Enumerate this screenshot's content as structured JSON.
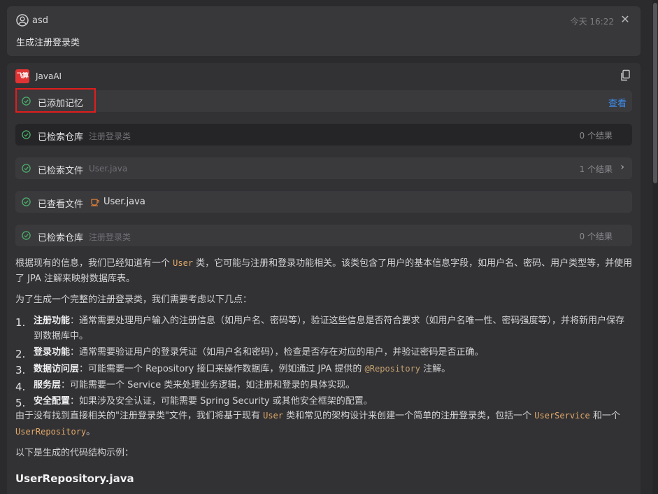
{
  "user": {
    "name": "asd",
    "time": "今天 16:22",
    "message": "生成注册登录类"
  },
  "ai": {
    "logo_text": "飞算",
    "name": "JavaAI"
  },
  "steps": [
    {
      "label": "已添加记忆",
      "action": "查看"
    },
    {
      "label": "已检索仓库",
      "sub": "注册登录类",
      "result": "0 个结果"
    },
    {
      "label": "已检索文件",
      "sub": "User.java",
      "result": "1 个结果"
    },
    {
      "label": "已查看文件",
      "file": "User.java"
    },
    {
      "label": "已检索仓库",
      "sub": "注册登录类",
      "result": "0 个结果"
    }
  ],
  "content": {
    "p1_a": "根据现有的信息，我们已经知道有一个 ",
    "p1_code": "User",
    "p1_b": " 类，它可能与注册和登录功能相关。该类包含了用户的基本信息字段，如用户名、密码、用户类型等，并使用了 JPA 注解来映射数据库表。",
    "p2": "为了生成一个完整的注册登录类，我们需要考虑以下几点：",
    "points": [
      {
        "num": "1.",
        "title": "注册功能",
        "text": "：通常需要处理用户输入的注册信息（如用户名、密码等），验证这些信息是否符合要求（如用户名唯一性、密码强度等），并将新用户保存到数据库中。"
      },
      {
        "num": "2.",
        "title": "登录功能",
        "text": "：通常需要验证用户的登录凭证（如用户名和密码），检查是否存在对应的用户，并验证密码是否正确。"
      },
      {
        "num": "3.",
        "title": "数据访问层",
        "text_a": "：可能需要一个 Repository 接口来操作数据库，例如通过 JPA 提供的 ",
        "code": "@Repository",
        "text_b": " 注解。"
      },
      {
        "num": "4.",
        "title": "服务层",
        "text": "：可能需要一个 Service 类来处理业务逻辑，如注册和登录的具体实现。"
      },
      {
        "num": "5.",
        "title": "安全配置",
        "text": "：如果涉及安全认证，可能需要 Spring Security 或其他安全框架的配置。"
      }
    ],
    "p3_a": "由于没有找到直接相关的\"注册登录类\"文件，我们将基于现有 ",
    "p3_code1": "User",
    "p3_b": " 类和常见的架构设计来创建一个简单的注册登录类，包括一个 ",
    "p3_code2": "UserService",
    "p3_c": " 和一个 ",
    "p3_code3": "UserRepository",
    "p3_d": "。",
    "p4": "以下是生成的代码结构示例：",
    "heading": "UserRepository.java"
  },
  "colors": {
    "accent_link": "#3d8ef0",
    "check_green": "#4caf6a",
    "highlight_red": "#e11d1d",
    "code_orange": "#e2a86a"
  }
}
